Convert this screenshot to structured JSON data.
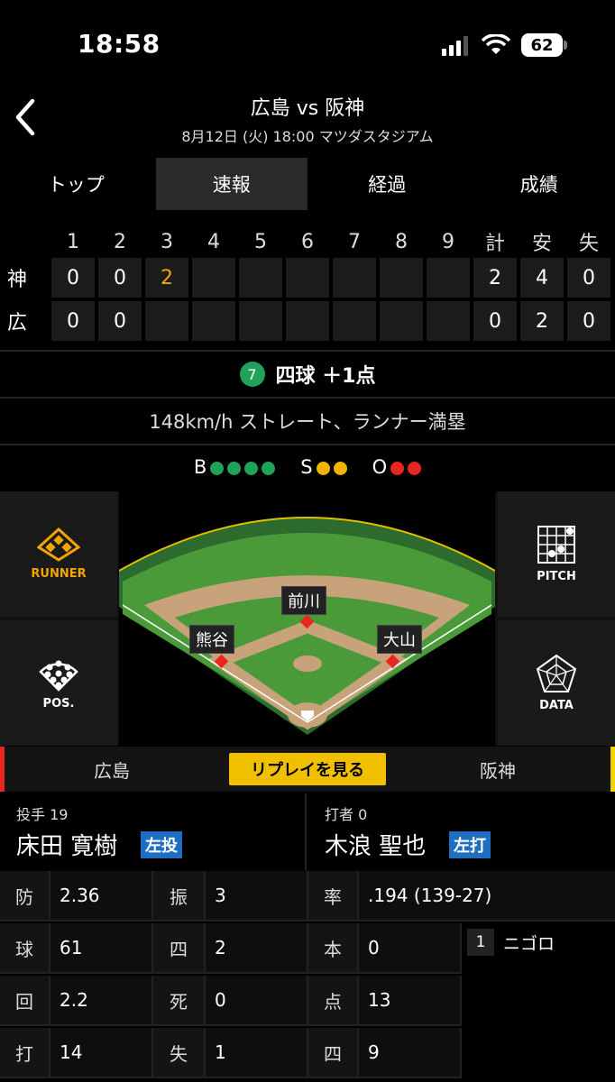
{
  "status": {
    "time": "18:58",
    "battery": "62"
  },
  "header": {
    "title": "広島 vs 阪神",
    "subtitle": "8月12日 (火) 18:00 マツダスタジアム"
  },
  "tabs": [
    "トップ",
    "速報",
    "経過",
    "成績"
  ],
  "scoreboard": {
    "headers": [
      "1",
      "2",
      "3",
      "4",
      "5",
      "6",
      "7",
      "8",
      "9",
      "計",
      "安",
      "失"
    ],
    "rows": [
      {
        "team": "神",
        "cells": [
          "0",
          "0",
          "2",
          "",
          "",
          "",
          "",
          "",
          "",
          "2",
          "4",
          "0"
        ]
      },
      {
        "team": "広",
        "cells": [
          "0",
          "0",
          "",
          "",
          "",
          "",
          "",
          "",
          "",
          "0",
          "2",
          "0"
        ]
      }
    ]
  },
  "play": {
    "number": "7",
    "text": "四球 ＋1点"
  },
  "pitch_text": "148km/h ストレート、ランナー満塁",
  "count": {
    "b_label": "B",
    "balls": 4,
    "s_label": "S",
    "strikes": 2,
    "o_label": "O",
    "outs": 2
  },
  "field": {
    "fielders": {
      "second": "前川",
      "third": "熊谷",
      "first": "大山"
    },
    "buttons": {
      "runner": "RUNNER",
      "pitch": "PITCH",
      "pos": "POS.",
      "data": "DATA"
    }
  },
  "team_bar": {
    "home": "広島",
    "replay": "リプレイを見る",
    "away": "阪神"
  },
  "pitcher": {
    "role": "投手 19",
    "name": "床田 寛樹",
    "hand": "左投"
  },
  "batter": {
    "role": "打者 0",
    "name": "木浪 聖也",
    "hand": "左打"
  },
  "pitcher_stats": [
    {
      "k1": "防",
      "v1": "2.36",
      "k2": "振",
      "v2": "3"
    },
    {
      "k1": "球",
      "v1": "61",
      "k2": "四",
      "v2": "2"
    },
    {
      "k1": "回",
      "v1": "2.2",
      "k2": "死",
      "v2": "0"
    },
    {
      "k1": "打",
      "v1": "14",
      "k2": "失",
      "v2": "1"
    }
  ],
  "batter_stats": {
    "avg_key": "率",
    "avg_val": ".194 (139-27)",
    "rows": [
      {
        "k": "本",
        "v": "0"
      },
      {
        "k": "点",
        "v": "13"
      },
      {
        "k": "四",
        "v": "9"
      }
    ]
  },
  "at_bats": [
    {
      "num": "1",
      "result": "ニゴロ"
    }
  ],
  "colors": {
    "ball": "#1fa35a",
    "strike": "#f0b400",
    "out": "#e8261f",
    "highlight": "#f0a500",
    "replay": "#f0c000",
    "badge": "#1e6fc1"
  }
}
